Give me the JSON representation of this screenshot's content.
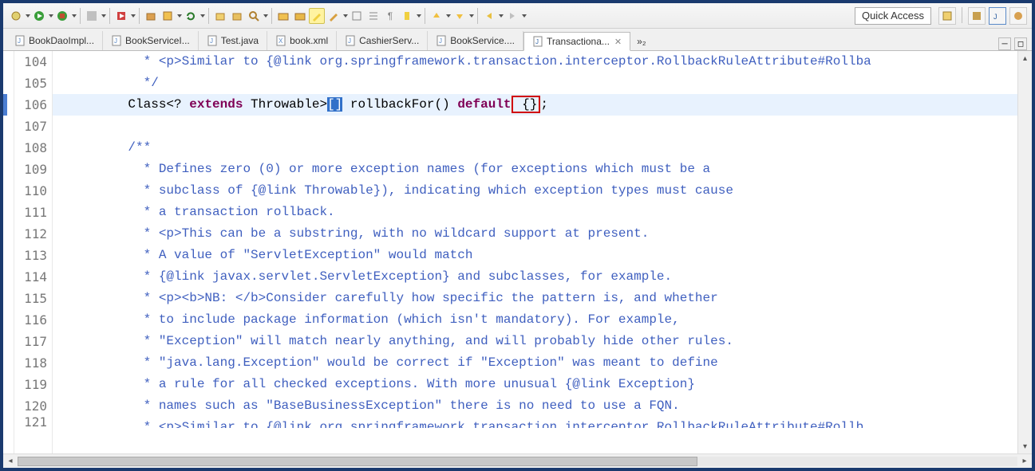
{
  "toolbar": {
    "quick_access": "Quick Access"
  },
  "tabs": [
    {
      "label": "BookDaoImpl...",
      "icon": "java"
    },
    {
      "label": "BookServiceI...",
      "icon": "java"
    },
    {
      "label": "Test.java",
      "icon": "java"
    },
    {
      "label": "book.xml",
      "icon": "xml"
    },
    {
      "label": "CashierServ...",
      "icon": "java"
    },
    {
      "label": "BookService....",
      "icon": "java"
    },
    {
      "label": "Transactiona...",
      "icon": "class",
      "active": true
    }
  ],
  "tab_overflow": "»₂",
  "code": {
    "lines": [
      {
        "n": 104,
        "indent": "          ",
        "tokens": [
          {
            "t": " * <p>Similar to {@link org.springframework.transaction.interceptor.RollbackRuleAttribute#Rollba",
            "cls": "c-comment"
          }
        ]
      },
      {
        "n": 105,
        "indent": "          ",
        "tokens": [
          {
            "t": " */",
            "cls": "c-comment"
          }
        ]
      },
      {
        "n": 106,
        "active": true,
        "indent": "         ",
        "tokens": [
          {
            "t": "Class<? ",
            "cls": "c-default"
          },
          {
            "t": "extends",
            "cls": "c-keyword"
          },
          {
            "t": " Throwable>",
            "cls": "c-default"
          },
          {
            "t": "[]",
            "cls": "sel"
          },
          {
            "t": " rollbackFor() ",
            "cls": "c-default"
          },
          {
            "t": "default",
            "cls": "c-keyword"
          },
          {
            "t": " {}",
            "cls": "c-default red-box"
          },
          {
            "t": ";",
            "cls": "c-default"
          }
        ]
      },
      {
        "n": 107,
        "indent": "",
        "tokens": []
      },
      {
        "n": 108,
        "fold": true,
        "indent": "         ",
        "tokens": [
          {
            "t": "/**",
            "cls": "c-comment"
          }
        ]
      },
      {
        "n": 109,
        "indent": "          ",
        "tokens": [
          {
            "t": " * Defines zero (0) or more exception names (for exceptions which must be a",
            "cls": "c-comment"
          }
        ]
      },
      {
        "n": 110,
        "indent": "          ",
        "tokens": [
          {
            "t": " * subclass of {@link Throwable}), indicating which exception types must cause",
            "cls": "c-comment"
          }
        ]
      },
      {
        "n": 111,
        "indent": "          ",
        "tokens": [
          {
            "t": " * a transaction rollback.",
            "cls": "c-comment"
          }
        ]
      },
      {
        "n": 112,
        "indent": "          ",
        "tokens": [
          {
            "t": " * <p>This can be a substring, with no wildcard support at present.",
            "cls": "c-comment"
          }
        ]
      },
      {
        "n": 113,
        "indent": "          ",
        "tokens": [
          {
            "t": " * A value of \"ServletException\" would match",
            "cls": "c-comment"
          }
        ]
      },
      {
        "n": 114,
        "indent": "          ",
        "tokens": [
          {
            "t": " * {@link javax.servlet.ServletException} and subclasses, for example.",
            "cls": "c-comment"
          }
        ]
      },
      {
        "n": 115,
        "indent": "          ",
        "tokens": [
          {
            "t": " * <p><b>NB: </b>Consider carefully how specific the pattern is, and whether",
            "cls": "c-comment"
          }
        ]
      },
      {
        "n": 116,
        "indent": "          ",
        "tokens": [
          {
            "t": " * to include package information (which isn't mandatory). For example,",
            "cls": "c-comment"
          }
        ]
      },
      {
        "n": 117,
        "indent": "          ",
        "tokens": [
          {
            "t": " * \"Exception\" will match nearly anything, and will probably hide other rules.",
            "cls": "c-comment"
          }
        ]
      },
      {
        "n": 118,
        "indent": "          ",
        "tokens": [
          {
            "t": " * \"java.lang.Exception\" would be correct if \"Exception\" was meant to define",
            "cls": "c-comment"
          }
        ]
      },
      {
        "n": 119,
        "indent": "          ",
        "tokens": [
          {
            "t": " * a rule for all checked exceptions. With more unusual {@link Exception}",
            "cls": "c-comment"
          }
        ]
      },
      {
        "n": 120,
        "indent": "          ",
        "tokens": [
          {
            "t": " * names such as \"BaseBusinessException\" there is no need to use a FQN.",
            "cls": "c-comment"
          }
        ]
      },
      {
        "n": 121,
        "cut": true,
        "indent": "          ",
        "tokens": [
          {
            "t": " * <p>Similar to {@link org.springframework.transaction.interceptor.RollbackRuleAttribute#Rollb",
            "cls": "c-comment"
          }
        ]
      }
    ]
  }
}
